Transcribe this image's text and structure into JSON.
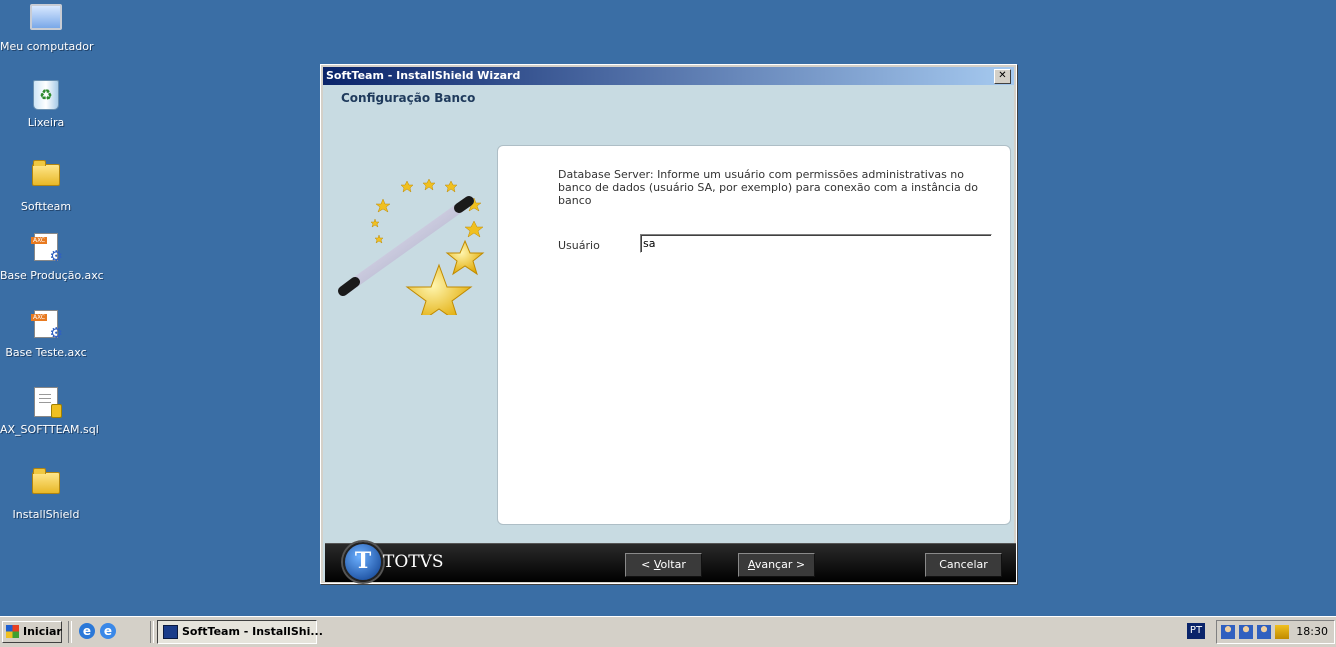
{
  "desktop": {
    "icons": [
      {
        "label": "Meu computador",
        "icon": "my-computer-icon"
      },
      {
        "label": "Lixeira",
        "icon": "recycle-bin-icon"
      },
      {
        "label": "Softteam",
        "icon": "folder-icon"
      },
      {
        "label": "Base Produção.axc",
        "icon": "axc-file-icon"
      },
      {
        "label": "Base Teste.axc",
        "icon": "axc-file-icon"
      },
      {
        "label": "AX_SOFTTEAM.sql",
        "icon": "sql-file-icon"
      },
      {
        "label": "InstallShield",
        "icon": "folder-icon"
      }
    ]
  },
  "window": {
    "title": "SoftTeam - InstallShield Wizard",
    "close_label": "✕",
    "header_title": "Configuração Banco",
    "description": "Database Server: Informe um usuário com permissões administrativas no banco de dados (usuário SA, por exemplo) para conexão com a instância do banco",
    "user_label": "Usuário",
    "user_value": "sa",
    "brand": "TOTVS",
    "brand_initial": "T",
    "buttons": {
      "back": {
        "prefix": "< ",
        "mnemonic": "V",
        "rest": "oltar"
      },
      "next": {
        "mnemonic": "A",
        "rest": "vançar",
        "suffix": " >"
      },
      "cancel": "Cancelar"
    }
  },
  "taskbar": {
    "start_label": "Iniciar",
    "active_task": "SoftTeam - InstallShi...",
    "language": "PT",
    "clock": "18:30"
  },
  "colors": {
    "desktop": "#3a6ea5",
    "wizard_bg": "#c8dbe2",
    "title_accent": "#1f3a5c"
  }
}
